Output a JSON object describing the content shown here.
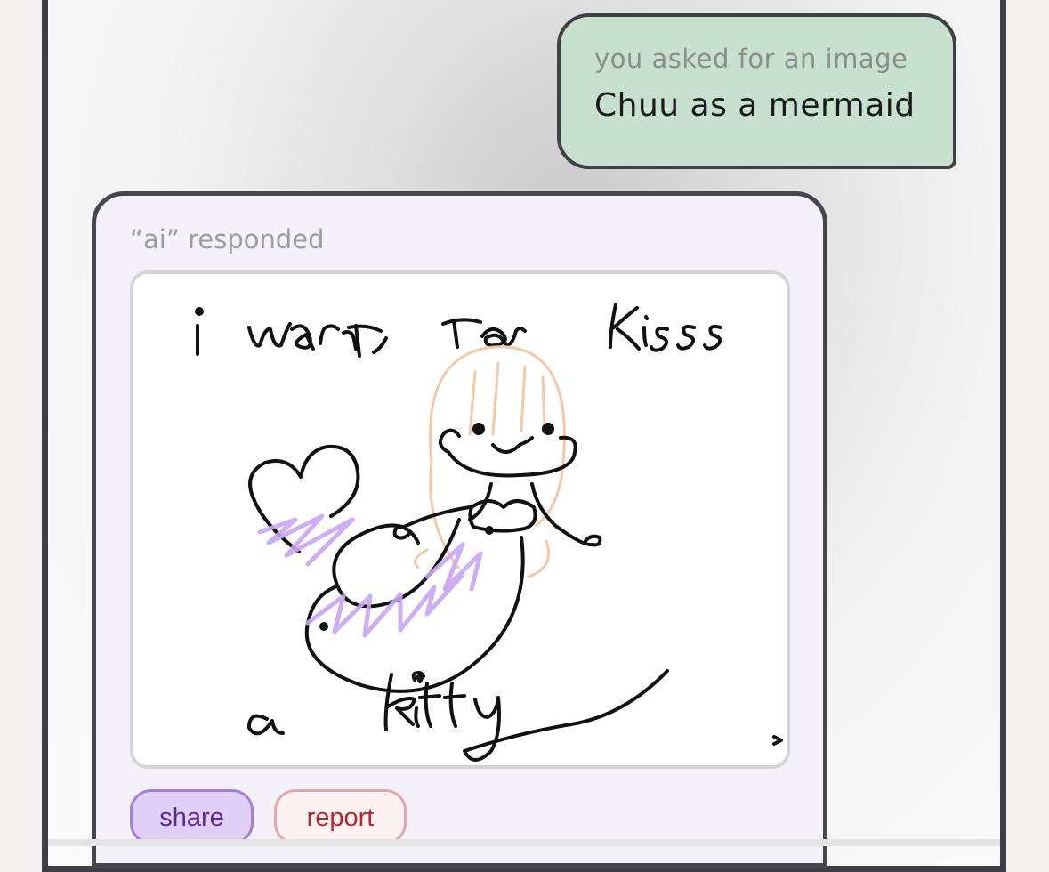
{
  "user_message": {
    "caption": "you asked for an image",
    "text": "Chuu as a mermaid"
  },
  "ai_response": {
    "caption": "“ai” responded",
    "drawing": {
      "description_icon": "hand-drawn-mermaid-image",
      "handwritten_top": "i want to kiss",
      "handwritten_bottom": "a kitty"
    },
    "share_label": "share",
    "report_label": "report"
  },
  "colors": {
    "user_bubble": "#c8e1cf",
    "ai_card": "#f4f1fb",
    "share_accent": "#a37fd9",
    "report_accent": "#b3282e"
  }
}
